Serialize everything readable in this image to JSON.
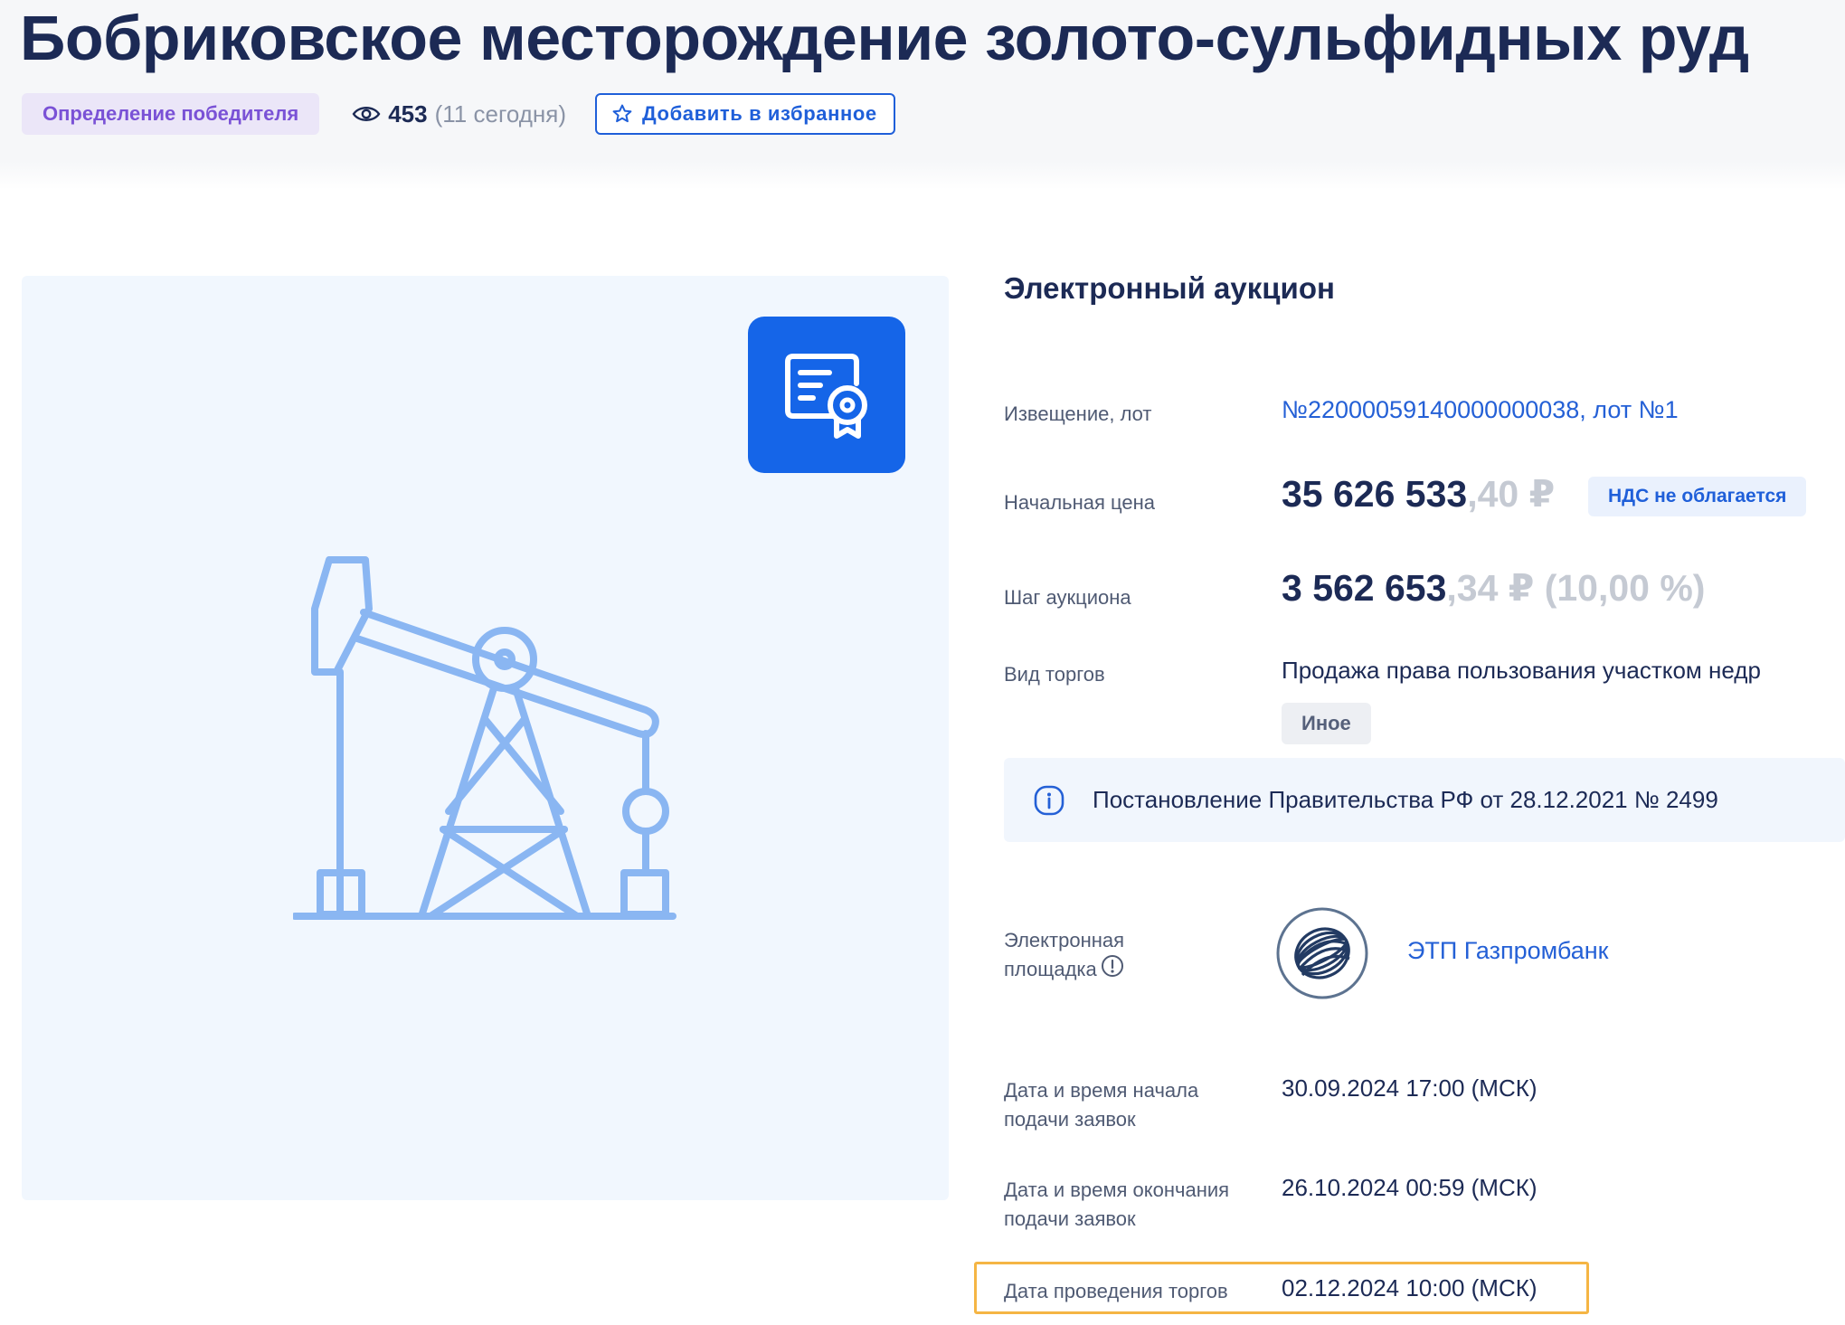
{
  "title": "Бобриковское месторождение золото-сульфидных руд",
  "status_badge": "Определение победителя",
  "views": {
    "count": "453",
    "today": "(11 сегодня)"
  },
  "favorite_button": "Добавить в избранное",
  "auction_type": "Электронный аукцион",
  "notice": {
    "label": "Извещение, лот",
    "value": "№22000059140000000038, лот №1"
  },
  "start_price": {
    "label": "Начальная цена",
    "main": "35 626 533",
    "fraction": ",40 ₽",
    "vat": "НДС не облагается"
  },
  "auction_step": {
    "label": "Шаг аукциона",
    "main": "3 562 653",
    "fraction": ",34 ₽ (10,00 %)"
  },
  "trade_kind": {
    "label": "Вид торгов",
    "value": "Продажа права пользования участком недр",
    "tag": "Иное"
  },
  "regulation": "Постановление Правительства РФ от 28.12.2021 № 2499",
  "platform": {
    "label_line1": "Электронная",
    "label_line2": "площадка",
    "name": "ЭТП Газпромбанк"
  },
  "application_start": {
    "label_line1": "Дата и время начала",
    "label_line2": "подачи заявок",
    "value": "30.09.2024 17:00 (МСК)"
  },
  "application_end": {
    "label_line1": "Дата и время окончания",
    "label_line2": "подачи заявок",
    "value": "26.10.2024 00:59 (МСК)"
  },
  "trade_date": {
    "label": "Дата проведения торгов",
    "value": "02.12.2024 10:00 (МСК)"
  },
  "colors": {
    "accent": "#1f5fd9",
    "status": "#7a52d6",
    "highlight": "#f5b544",
    "illustration": "#8ab6f2"
  },
  "icons": {
    "views": "eye-icon",
    "favorite": "star-icon",
    "category": "certificate-icon",
    "illustration": "oil-pump-icon",
    "info": "info-icon",
    "platform": "gazprombank-logo"
  }
}
